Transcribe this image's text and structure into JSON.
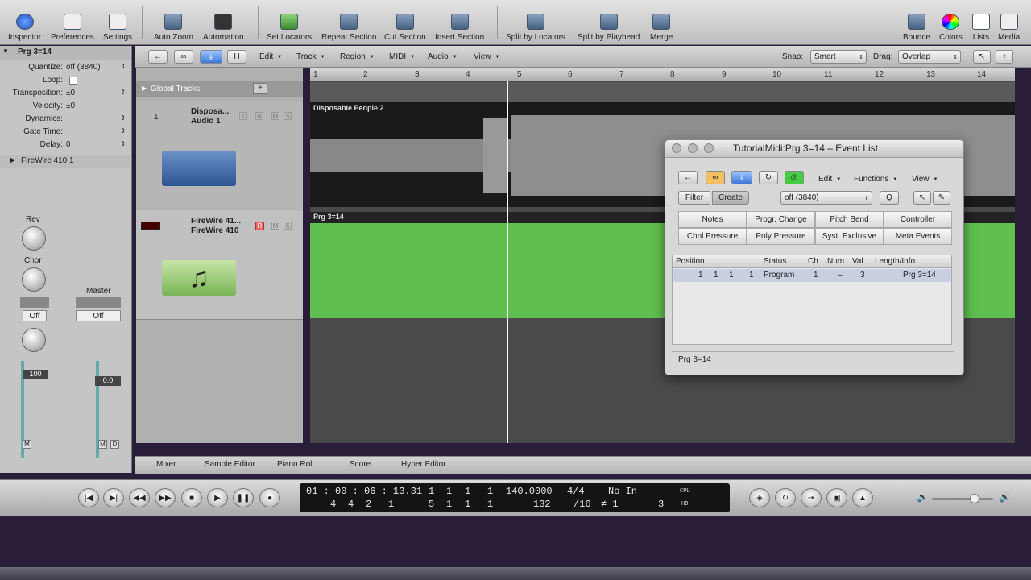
{
  "toolbar": {
    "inspector": "Inspector",
    "preferences": "Preferences",
    "settings": "Settings",
    "auto_zoom": "Auto Zoom",
    "automation": "Automation",
    "set_locators": "Set Locators",
    "repeat_section": "Repeat Section",
    "cut_section": "Cut Section",
    "insert_section": "Insert Section",
    "split_by_locators": "Split by Locators",
    "split_by_playhead": "Split by Playhead",
    "merge": "Merge",
    "bounce": "Bounce",
    "colors": "Colors",
    "lists": "Lists",
    "media": "Media"
  },
  "local_bar": {
    "h_label": "H",
    "edit": "Edit",
    "track": "Track",
    "region": "Region",
    "midi": "MIDI",
    "audio": "Audio",
    "view": "View",
    "snap_label": "Snap:",
    "snap_value": "Smart",
    "drag_label": "Drag:",
    "drag_value": "Overlap"
  },
  "inspector": {
    "region_name": "Prg  3=14",
    "params": [
      {
        "label": "Quantize:",
        "value": "off (3840)"
      },
      {
        "label": "Loop:",
        "value": ""
      },
      {
        "label": "Transposition:",
        "value": "±0"
      },
      {
        "label": "Velocity:",
        "value": "±0"
      },
      {
        "label": "Dynamics:",
        "value": ""
      },
      {
        "label": "Gate Time:",
        "value": ""
      },
      {
        "label": "Delay:",
        "value": "0"
      }
    ],
    "track_name": "FireWire 410  1",
    "rev": "Rev",
    "chor": "Chor",
    "master": "Master",
    "off1": "Off",
    "off2": "Off",
    "vol1": "100",
    "vol2": "0.0",
    "m": "M",
    "s": "S",
    "d": "D"
  },
  "global_tracks": "Global Tracks",
  "tracks": [
    {
      "num": "1",
      "name1": "Disposa...",
      "name2": "Audio 1",
      "btns": [
        "I",
        "R",
        "M",
        "S"
      ]
    },
    {
      "num": "",
      "name1": "FireWire 41...",
      "name2": "FireWire 410",
      "btns": [
        "R",
        "M",
        "S"
      ]
    }
  ],
  "ruler_ticks": [
    "1",
    "2",
    "3",
    "4",
    "5",
    "6",
    "7",
    "8",
    "9",
    "10",
    "11",
    "12",
    "13",
    "14"
  ],
  "regions": {
    "audio": "Disposable People.2",
    "midi": "Prg  3=14"
  },
  "event_list": {
    "title": "TutorialMidi:Prg  3=14 – Event List",
    "edit": "Edit",
    "functions": "Functions",
    "view": "View",
    "filter": "Filter",
    "create": "Create",
    "quantize": "off (3840)",
    "q": "Q",
    "types": [
      "Notes",
      "Progr. Change",
      "Pitch Bend",
      "Controller",
      "Chnl Pressure",
      "Poly Pressure",
      "Syst. Exclusive",
      "Meta Events"
    ],
    "columns": [
      "Position",
      "Status",
      "Ch",
      "Num",
      "Val",
      "Length/Info"
    ],
    "row": {
      "pos": [
        "1",
        "1",
        "1",
        "1"
      ],
      "status": "Program",
      "ch": "1",
      "num": "–",
      "val": "3",
      "info": "Prg  3=14"
    },
    "footer": "Prg  3=14"
  },
  "bottom_tabs": [
    "Mixer",
    "Sample Editor",
    "Piano Roll",
    "Score",
    "Hyper Editor"
  ],
  "transport": {
    "time": "01 : 00 : 06 : 13.31",
    "bars": [
      "4",
      "4",
      "2",
      "1"
    ],
    "pos1": [
      "1",
      "1",
      "1",
      "1"
    ],
    "pos2": [
      "5",
      "1",
      "1",
      "1"
    ],
    "tempo": "140.0000",
    "bpm_row": "132",
    "sig": "4/4",
    "div": "/16",
    "in": "No In",
    "sharp": "≠ 1",
    "out": "3",
    "cpu": "CPU",
    "hd": "HD"
  },
  "colors": {
    "midi_region": "#5fbf4f",
    "toolbar": "#d0d0d0"
  }
}
